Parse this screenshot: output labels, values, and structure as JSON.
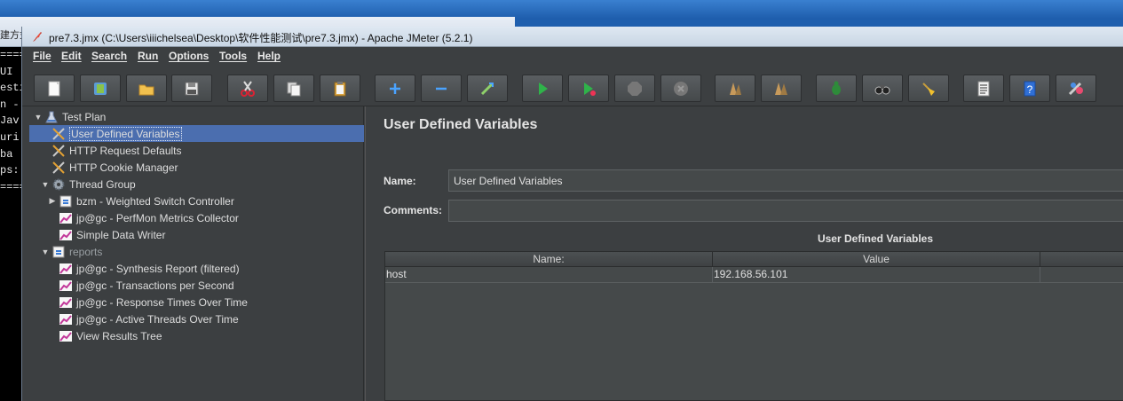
{
  "background": {
    "fragment_title": "建方式",
    "console_lines": [
      "====",
      "UI",
      "esti",
      "n -",
      "Jav",
      "uri",
      "ba",
      "ps:",
      "===="
    ]
  },
  "window": {
    "title": "pre7.3.jmx (C:\\Users\\iiichelsea\\Desktop\\软件性能测试\\pre7.3.jmx) - Apache JMeter (5.2.1)"
  },
  "menu": [
    "File",
    "Edit",
    "Search",
    "Run",
    "Options",
    "Tools",
    "Help"
  ],
  "toolbar": [
    {
      "name": "new-icon"
    },
    {
      "name": "templates-icon"
    },
    {
      "name": "open-icon"
    },
    {
      "name": "save-icon"
    },
    {
      "name": "cut-icon"
    },
    {
      "name": "copy-icon"
    },
    {
      "name": "paste-icon"
    },
    {
      "name": "expand-icon"
    },
    {
      "name": "collapse-icon"
    },
    {
      "name": "toggle-icon"
    },
    {
      "name": "start-icon"
    },
    {
      "name": "start-no-pauses-icon"
    },
    {
      "name": "stop-icon"
    },
    {
      "name": "shutdown-icon"
    },
    {
      "name": "remote-start-icon"
    },
    {
      "name": "remote-stop-icon"
    },
    {
      "name": "clear-icon"
    },
    {
      "name": "clear-all-icon"
    },
    {
      "name": "search-icon"
    },
    {
      "name": "function-helper-icon"
    },
    {
      "name": "help-icon"
    },
    {
      "name": "remote-exit-icon"
    }
  ],
  "tree": {
    "items": [
      {
        "label": "Test Plan"
      },
      {
        "label": "User Defined Variables"
      },
      {
        "label": "HTTP Request Defaults"
      },
      {
        "label": "HTTP Cookie Manager"
      },
      {
        "label": "Thread Group"
      },
      {
        "label": "bzm - Weighted Switch Controller"
      },
      {
        "label": "jp@gc - PerfMon Metrics Collector"
      },
      {
        "label": "Simple Data Writer"
      },
      {
        "label": "reports"
      },
      {
        "label": "jp@gc - Synthesis Report (filtered)"
      },
      {
        "label": "jp@gc - Transactions per Second"
      },
      {
        "label": "jp@gc - Response Times Over Time"
      },
      {
        "label": "jp@gc - Active Threads Over Time"
      },
      {
        "label": "View Results Tree"
      }
    ]
  },
  "panel": {
    "title": "User Defined Variables",
    "name_label": "Name:",
    "name_value": "User Defined Variables",
    "comments_label": "Comments:",
    "comments_value": "",
    "table_caption": "User Defined Variables",
    "columns": [
      "Name:",
      "Value"
    ],
    "rows": [
      {
        "name": "host",
        "value": "192.168.56.101"
      }
    ]
  }
}
